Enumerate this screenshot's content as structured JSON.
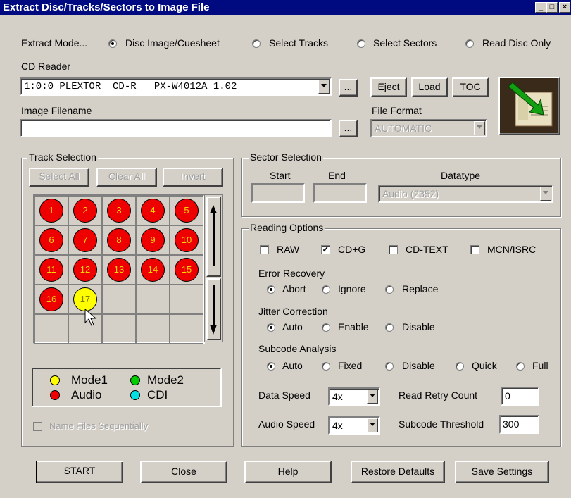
{
  "window": {
    "title": "Extract Disc/Tracks/Sectors to Image File",
    "controls": [
      "_",
      "□",
      "×"
    ]
  },
  "extract_mode": {
    "label": "Extract Mode...",
    "options": [
      "Disc Image/Cuesheet",
      "Select Tracks",
      "Select Sectors",
      "Read Disc Only"
    ],
    "selected": "Disc Image/Cuesheet"
  },
  "cd_reader": {
    "label": "CD Reader",
    "value": "1:0:0 PLEXTOR  CD-R   PX-W4012A 1.02",
    "browse": "...",
    "eject": "Eject",
    "load": "Load",
    "toc": "TOC"
  },
  "image_filename": {
    "label": "Image Filename",
    "value": "",
    "browse": "..."
  },
  "file_format": {
    "label": "File Format",
    "value": "AUTOMATIC"
  },
  "track_selection": {
    "label": "Track Selection",
    "select_all": "Select All",
    "clear_all": "Clear All",
    "invert": "Invert",
    "tracks": [
      {
        "n": "1",
        "color": "red"
      },
      {
        "n": "2",
        "color": "red"
      },
      {
        "n": "3",
        "color": "red"
      },
      {
        "n": "4",
        "color": "red"
      },
      {
        "n": "5",
        "color": "red"
      },
      {
        "n": "6",
        "color": "red"
      },
      {
        "n": "7",
        "color": "red"
      },
      {
        "n": "8",
        "color": "red"
      },
      {
        "n": "9",
        "color": "red"
      },
      {
        "n": "10",
        "color": "red"
      },
      {
        "n": "11",
        "color": "red"
      },
      {
        "n": "12",
        "color": "red"
      },
      {
        "n": "13",
        "color": "red"
      },
      {
        "n": "14",
        "color": "red"
      },
      {
        "n": "15",
        "color": "red"
      },
      {
        "n": "16",
        "color": "red"
      },
      {
        "n": "17",
        "color": "yellow"
      }
    ],
    "legend": {
      "mode1": "Mode1",
      "mode2": "Mode2",
      "audio": "Audio",
      "cdi": "CDI"
    },
    "legend_colors": {
      "mode1": "#ffff00",
      "mode2": "#00cc00",
      "audio": "#ee0000",
      "cdi": "#00e0e0"
    },
    "name_files_sequentially": "Name Files Sequentially"
  },
  "sector_selection": {
    "label": "Sector Selection",
    "start": "Start",
    "end": "End",
    "datatype_label": "Datatype",
    "datatype": "Audio (2352)"
  },
  "reading_options": {
    "label": "Reading Options",
    "checks": [
      {
        "label": "RAW",
        "checked": false
      },
      {
        "label": "CD+G",
        "checked": true
      },
      {
        "label": "CD-TEXT",
        "checked": false
      },
      {
        "label": "MCN/ISRC",
        "checked": false
      }
    ],
    "error_recovery": {
      "label": "Error Recovery",
      "options": [
        "Abort",
        "Ignore",
        "Replace"
      ],
      "selected": "Abort"
    },
    "jitter_correction": {
      "label": "Jitter Correction",
      "options": [
        "Auto",
        "Enable",
        "Disable"
      ],
      "selected": "Auto"
    },
    "subcode_analysis": {
      "label": "Subcode Analysis",
      "options": [
        "Auto",
        "Fixed",
        "Disable",
        "Quick",
        "Full"
      ],
      "selected": "Auto"
    },
    "data_speed": {
      "label": "Data Speed",
      "value": "4x"
    },
    "audio_speed": {
      "label": "Audio Speed",
      "value": "4x"
    },
    "read_retry_count": {
      "label": "Read Retry Count",
      "value": "0"
    },
    "subcode_threshold": {
      "label": "Subcode Threshold",
      "value": "300"
    }
  },
  "buttons": {
    "start": "START",
    "close": "Close",
    "help": "Help",
    "restore": "Restore Defaults",
    "save": "Save Settings"
  }
}
